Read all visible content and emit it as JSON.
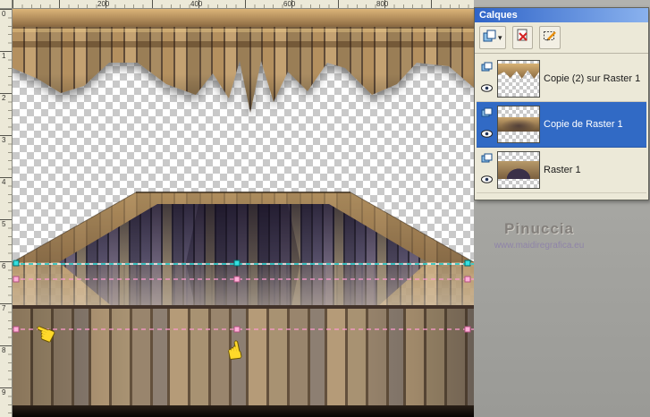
{
  "rulers": {
    "top": [
      "200",
      "400",
      "600",
      "800"
    ],
    "left": [
      "0",
      "1",
      "2",
      "3",
      "4",
      "5",
      "6",
      "7",
      "8",
      "9"
    ]
  },
  "canvas": {
    "selection_color": "#19d3d3",
    "mesh_color": "#ff9ac4"
  },
  "icons": {
    "dropdown_arrow": "▾",
    "hand": "☚"
  },
  "layers_palette": {
    "title": "Calques",
    "layers": [
      {
        "label": "Copie (2) sur Raster 1",
        "selected": false
      },
      {
        "label": "Copie de Raster 1",
        "selected": true
      },
      {
        "label": "Raster 1",
        "selected": false
      }
    ]
  },
  "workspace": {
    "watermark_line1": "Pinuccia",
    "watermark_line2": "www.maidiregrafica.eu"
  }
}
